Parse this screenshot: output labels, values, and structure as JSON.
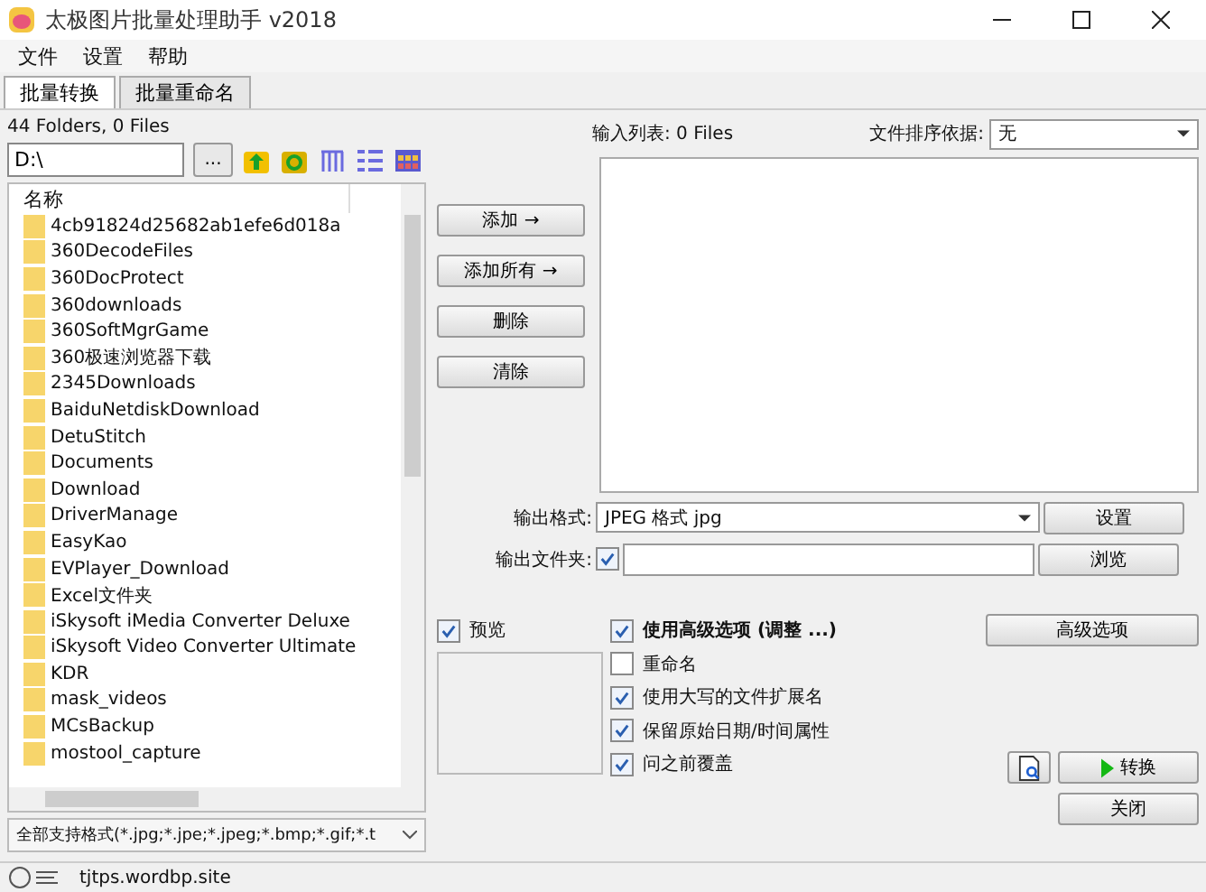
{
  "window": {
    "title": "太极图片批量处理助手 v2018"
  },
  "menu": [
    "文件",
    "设置",
    "帮助"
  ],
  "tabs": [
    {
      "label": "批量转换",
      "selected": true
    },
    {
      "label": "批量重命名",
      "selected": false
    }
  ],
  "browser": {
    "summary": "44 Folders, 0 Files",
    "path": "D:\\",
    "browse_button": "...",
    "column_header": "名称",
    "items": [
      "4cb91824d25682ab1efe6d018a",
      "360DecodeFiles",
      "360DocProtect",
      "360downloads",
      "360SoftMgrGame",
      "360极速浏览器下载",
      "2345Downloads",
      "BaiduNetdiskDownload",
      "DetuStitch",
      "Documents",
      "Download",
      "DriverManage",
      "EasyKao",
      "EVPlayer_Download",
      "Excel文件夹",
      "iSkysoft iMedia Converter Deluxe",
      "iSkysoft Video Converter Ultimate",
      "KDR",
      "mask_videos",
      "MCsBackup",
      "mostool_capture"
    ],
    "filter": "全部支持格式(*.jpg;*.jpe;*.jpeg;*.bmp;*.gif;*.t"
  },
  "input_list": {
    "label": "输入列表: 0 Files",
    "sort_label": "文件排序依据:",
    "sort_value": "无"
  },
  "list_buttons": [
    "添加 →",
    "添加所有 →",
    "删除",
    "清除"
  ],
  "output": {
    "format_label": "输出格式:",
    "format_value": "JPEG 格式 jpg",
    "settings_button": "设置",
    "folder_label": "输出文件夹:",
    "folder_checked": true,
    "browse_button": "浏览"
  },
  "preview": {
    "label": "预览",
    "checked": true
  },
  "options": [
    {
      "label": "使用高级选项 (调整 ...)",
      "checked": true,
      "bold": true
    },
    {
      "label": "重命名",
      "checked": false,
      "bold": false
    },
    {
      "label": "使用大写的文件扩展名",
      "checked": true,
      "bold": false
    },
    {
      "label": "保留原始日期/时间属性",
      "checked": true,
      "bold": false
    },
    {
      "label": "问之前覆盖",
      "checked": true,
      "bold": false
    }
  ],
  "advanced_button": "高级选项",
  "convert_button": "转换",
  "close_button": "关闭",
  "status_bar": "tjtps.wordbp.site"
}
